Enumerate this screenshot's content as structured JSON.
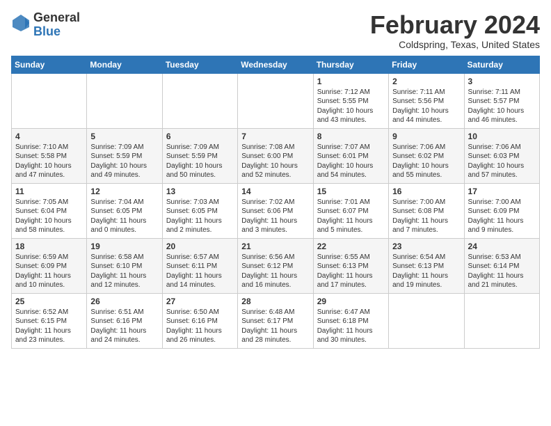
{
  "header": {
    "logo_general": "General",
    "logo_blue": "Blue",
    "month_title": "February 2024",
    "location": "Coldspring, Texas, United States"
  },
  "weekdays": [
    "Sunday",
    "Monday",
    "Tuesday",
    "Wednesday",
    "Thursday",
    "Friday",
    "Saturday"
  ],
  "weeks": [
    [
      {
        "day": "",
        "info": ""
      },
      {
        "day": "",
        "info": ""
      },
      {
        "day": "",
        "info": ""
      },
      {
        "day": "",
        "info": ""
      },
      {
        "day": "1",
        "info": "Sunrise: 7:12 AM\nSunset: 5:55 PM\nDaylight: 10 hours\nand 43 minutes."
      },
      {
        "day": "2",
        "info": "Sunrise: 7:11 AM\nSunset: 5:56 PM\nDaylight: 10 hours\nand 44 minutes."
      },
      {
        "day": "3",
        "info": "Sunrise: 7:11 AM\nSunset: 5:57 PM\nDaylight: 10 hours\nand 46 minutes."
      }
    ],
    [
      {
        "day": "4",
        "info": "Sunrise: 7:10 AM\nSunset: 5:58 PM\nDaylight: 10 hours\nand 47 minutes."
      },
      {
        "day": "5",
        "info": "Sunrise: 7:09 AM\nSunset: 5:59 PM\nDaylight: 10 hours\nand 49 minutes."
      },
      {
        "day": "6",
        "info": "Sunrise: 7:09 AM\nSunset: 5:59 PM\nDaylight: 10 hours\nand 50 minutes."
      },
      {
        "day": "7",
        "info": "Sunrise: 7:08 AM\nSunset: 6:00 PM\nDaylight: 10 hours\nand 52 minutes."
      },
      {
        "day": "8",
        "info": "Sunrise: 7:07 AM\nSunset: 6:01 PM\nDaylight: 10 hours\nand 54 minutes."
      },
      {
        "day": "9",
        "info": "Sunrise: 7:06 AM\nSunset: 6:02 PM\nDaylight: 10 hours\nand 55 minutes."
      },
      {
        "day": "10",
        "info": "Sunrise: 7:06 AM\nSunset: 6:03 PM\nDaylight: 10 hours\nand 57 minutes."
      }
    ],
    [
      {
        "day": "11",
        "info": "Sunrise: 7:05 AM\nSunset: 6:04 PM\nDaylight: 10 hours\nand 58 minutes."
      },
      {
        "day": "12",
        "info": "Sunrise: 7:04 AM\nSunset: 6:05 PM\nDaylight: 11 hours\nand 0 minutes."
      },
      {
        "day": "13",
        "info": "Sunrise: 7:03 AM\nSunset: 6:05 PM\nDaylight: 11 hours\nand 2 minutes."
      },
      {
        "day": "14",
        "info": "Sunrise: 7:02 AM\nSunset: 6:06 PM\nDaylight: 11 hours\nand 3 minutes."
      },
      {
        "day": "15",
        "info": "Sunrise: 7:01 AM\nSunset: 6:07 PM\nDaylight: 11 hours\nand 5 minutes."
      },
      {
        "day": "16",
        "info": "Sunrise: 7:00 AM\nSunset: 6:08 PM\nDaylight: 11 hours\nand 7 minutes."
      },
      {
        "day": "17",
        "info": "Sunrise: 7:00 AM\nSunset: 6:09 PM\nDaylight: 11 hours\nand 9 minutes."
      }
    ],
    [
      {
        "day": "18",
        "info": "Sunrise: 6:59 AM\nSunset: 6:09 PM\nDaylight: 11 hours\nand 10 minutes."
      },
      {
        "day": "19",
        "info": "Sunrise: 6:58 AM\nSunset: 6:10 PM\nDaylight: 11 hours\nand 12 minutes."
      },
      {
        "day": "20",
        "info": "Sunrise: 6:57 AM\nSunset: 6:11 PM\nDaylight: 11 hours\nand 14 minutes."
      },
      {
        "day": "21",
        "info": "Sunrise: 6:56 AM\nSunset: 6:12 PM\nDaylight: 11 hours\nand 16 minutes."
      },
      {
        "day": "22",
        "info": "Sunrise: 6:55 AM\nSunset: 6:13 PM\nDaylight: 11 hours\nand 17 minutes."
      },
      {
        "day": "23",
        "info": "Sunrise: 6:54 AM\nSunset: 6:13 PM\nDaylight: 11 hours\nand 19 minutes."
      },
      {
        "day": "24",
        "info": "Sunrise: 6:53 AM\nSunset: 6:14 PM\nDaylight: 11 hours\nand 21 minutes."
      }
    ],
    [
      {
        "day": "25",
        "info": "Sunrise: 6:52 AM\nSunset: 6:15 PM\nDaylight: 11 hours\nand 23 minutes."
      },
      {
        "day": "26",
        "info": "Sunrise: 6:51 AM\nSunset: 6:16 PM\nDaylight: 11 hours\nand 24 minutes."
      },
      {
        "day": "27",
        "info": "Sunrise: 6:50 AM\nSunset: 6:16 PM\nDaylight: 11 hours\nand 26 minutes."
      },
      {
        "day": "28",
        "info": "Sunrise: 6:48 AM\nSunset: 6:17 PM\nDaylight: 11 hours\nand 28 minutes."
      },
      {
        "day": "29",
        "info": "Sunrise: 6:47 AM\nSunset: 6:18 PM\nDaylight: 11 hours\nand 30 minutes."
      },
      {
        "day": "",
        "info": ""
      },
      {
        "day": "",
        "info": ""
      }
    ]
  ]
}
